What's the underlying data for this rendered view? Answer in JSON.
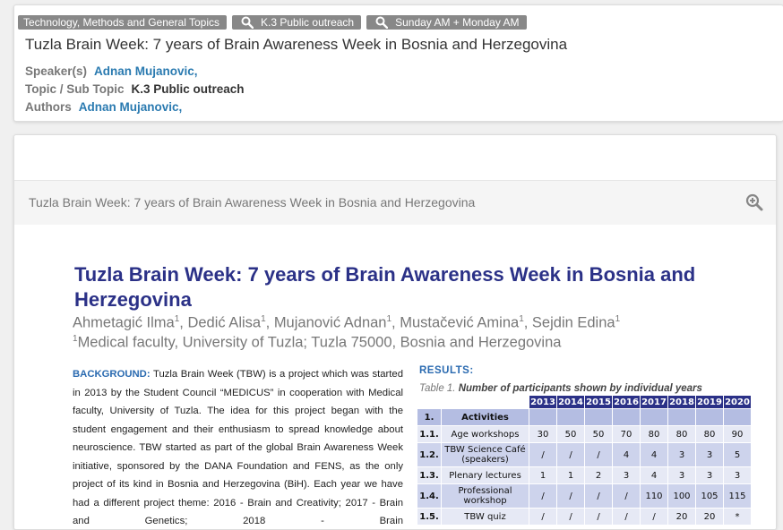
{
  "header": {
    "tags": [
      {
        "label": "Technology, Methods and General Topics",
        "icon": ""
      },
      {
        "label": "K.3 Public outreach",
        "icon": "search-icon"
      },
      {
        "label": "Sunday AM + Monday AM",
        "icon": "search-icon"
      }
    ],
    "title": "Tuzla Brain Week: 7 years of Brain Awareness Week in Bosnia and Herzegovina",
    "speakers_label": "Speaker(s)",
    "speakers_value": "Adnan Mujanovic,",
    "topic_label": "Topic / Sub Topic",
    "topic_value": "K.3 Public outreach",
    "authors_label": "Authors",
    "authors_value": "Adnan Mujanovic,"
  },
  "viewer": {
    "caption": "Tuzla Brain Week: 7 years of Brain Awareness Week in Bosnia and Herzegovina",
    "zoom_icon": "zoom-in-icon"
  },
  "poster": {
    "title": "Tuzla Brain Week: 7 years of Brain Awareness Week in Bosnia and Herzegovina",
    "authors": [
      {
        "name": "Ahmetagić Ilma",
        "sup": "1"
      },
      {
        "name": "Dedić Alisa",
        "sup": "1"
      },
      {
        "name": "Mujanović Adnan",
        "sup": "1"
      },
      {
        "name": "Mustačević Amina",
        "sup": "1"
      },
      {
        "name": "Sejdin Edina",
        "sup": "1"
      }
    ],
    "affiliation_sup": "1",
    "affiliation": "Medical faculty, University of Tuzla; Tuzla 75000, Bosnia and Herzegovina",
    "background_label": "BACKGROUND:",
    "background_text": "Tuzla Brain Week (TBW) is a project which was started in 2013 by the Student Council “MEDICUS” in cooperation with Medical faculty, University of Tuzla. The idea for this project began with the student engagement and their enthusiasm to spread knowledge about neuroscience. TBW started as part of the global Brain Awareness Week initiative, sponsored by the DANA Foundation and FENS, as the only project of its kind in Bosnia and Herzegovina (BiH). Each year we have had a different project theme: 2016 - Brain and Creativity; 2017 - Brain and Genetics; 2018 - Brain",
    "results_label": "RESULTS:",
    "table_caption_prefix": "Table 1.",
    "table_caption": "Number of participants shown by individual years",
    "table": {
      "years": [
        "2013",
        "2014",
        "2015",
        "2016",
        "2017",
        "2018",
        "2019",
        "2020"
      ],
      "header_num": "1.",
      "header_label": "Activities",
      "rows": [
        {
          "num": "1.1.",
          "label": "Age workshops",
          "values": [
            "30",
            "50",
            "50",
            "70",
            "80",
            "80",
            "80",
            "90"
          ],
          "tall": false
        },
        {
          "num": "1.2.",
          "label": "TBW Science Café (speakers)",
          "values": [
            "/",
            "/",
            "/",
            "4",
            "4",
            "3",
            "3",
            "5"
          ],
          "tall": true
        },
        {
          "num": "1.3.",
          "label": "Plenary lectures",
          "values": [
            "1",
            "1",
            "2",
            "3",
            "4",
            "3",
            "3",
            "3"
          ],
          "tall": false
        },
        {
          "num": "1.4.",
          "label": "Professional workshop",
          "values": [
            "/",
            "/",
            "/",
            "/",
            "110",
            "100",
            "105",
            "115"
          ],
          "tall": true
        },
        {
          "num": "1.5.",
          "label": "TBW quiz",
          "values": [
            "/",
            "/",
            "/",
            "/",
            "/",
            "20",
            "20",
            "*"
          ],
          "tall": false
        }
      ]
    }
  }
}
